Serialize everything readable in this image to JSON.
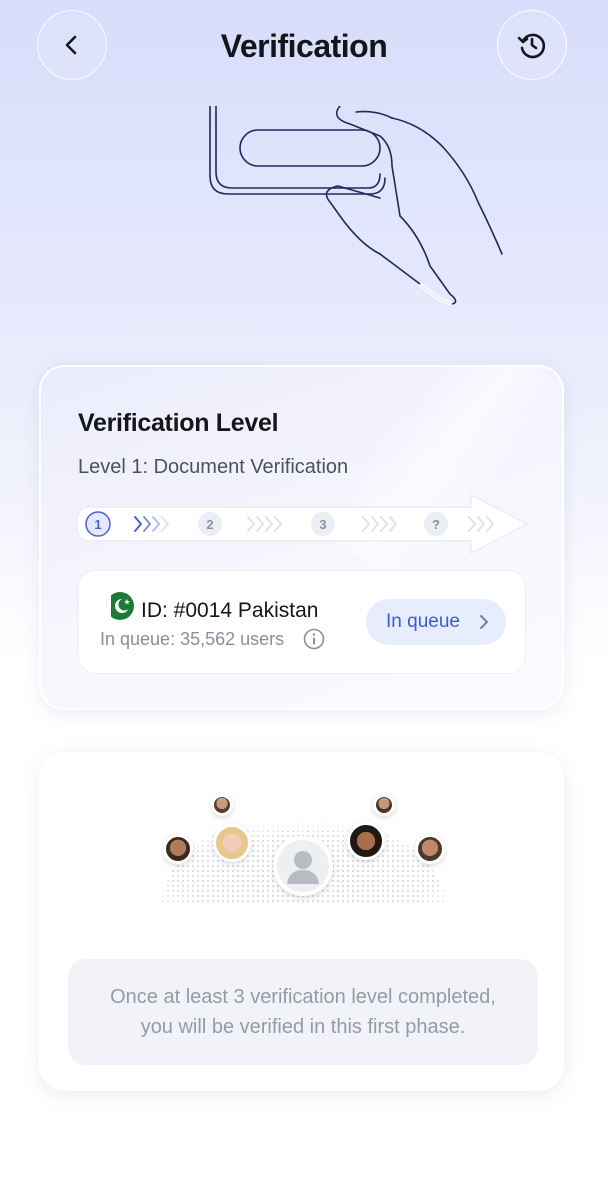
{
  "header": {
    "title": "Verification",
    "back_icon": "chevron-left-icon",
    "history_icon": "history-icon"
  },
  "level_card": {
    "title": "Verification Level",
    "subtitle": "Level 1: Document Verification",
    "steps": [
      "1",
      "2",
      "3",
      "?"
    ],
    "current_step": 1,
    "accent_color": "#4a63d6"
  },
  "queue": {
    "id_label": "ID: #0014 Pakistan",
    "count_label": "In queue: 35,562 users",
    "status_button": "In queue",
    "flag_icon": "pakistan-flag-icon",
    "info_icon": "info-icon"
  },
  "info_card": {
    "notice_line1": "Once at least 3 verification level completed,",
    "notice_line2": "you will be verified in this first phase."
  }
}
